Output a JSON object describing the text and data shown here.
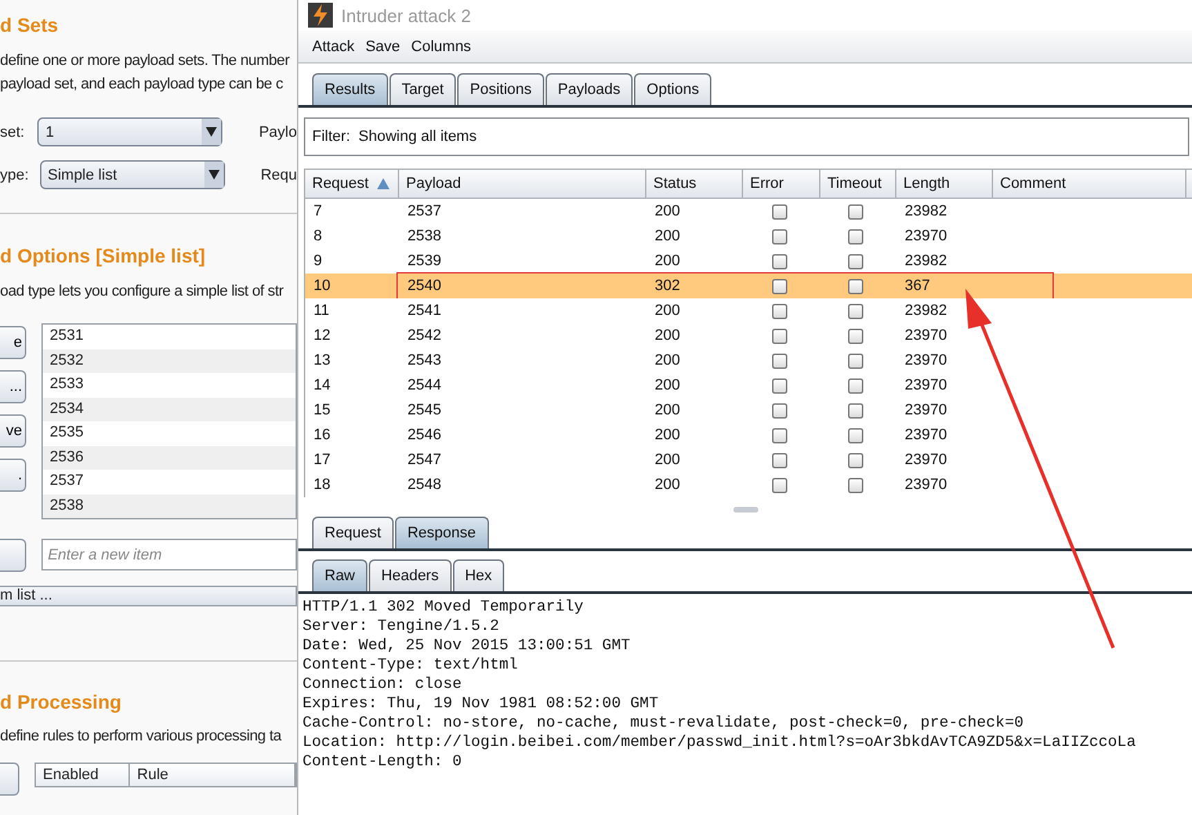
{
  "background_window": {
    "payload_sets": {
      "heading": "d Sets",
      "description": [
        "define one or more payload sets. The number",
        "payload set, and each payload type can be c"
      ],
      "fields": [
        {
          "label": "set:",
          "value": "1",
          "side_label": "Paylo"
        },
        {
          "label": "ype:",
          "value": "Simple list",
          "side_label": "Requ"
        }
      ]
    },
    "payload_options": {
      "heading": "d Options [Simple list]",
      "description": "oad type lets you configure a simple list of str",
      "buttons": [
        "e",
        "...",
        "ve",
        "."
      ],
      "items": [
        "2531",
        "2532",
        "2533",
        "2534",
        "2535",
        "2536",
        "2537",
        "2538"
      ],
      "new_item_placeholder": "Enter a new item",
      "list_dropdown": "m list ..."
    },
    "payload_processing": {
      "heading": "d Processing",
      "description": "define rules to perform various processing ta",
      "table_columns": [
        "Enabled",
        "Rule"
      ]
    }
  },
  "window": {
    "title": "Intruder attack 2",
    "menu": [
      "Attack",
      "Save",
      "Columns"
    ],
    "tabs": [
      {
        "label": "Results",
        "selected": true
      },
      {
        "label": "Target",
        "selected": false
      },
      {
        "label": "Positions",
        "selected": false
      },
      {
        "label": "Payloads",
        "selected": false
      },
      {
        "label": "Options",
        "selected": false
      }
    ],
    "filter": {
      "label": "Filter:",
      "value": "Showing all items"
    },
    "table": {
      "columns": [
        {
          "label": "Request",
          "sorted": true
        },
        {
          "label": "Payload",
          "sorted": false
        },
        {
          "label": "Status",
          "sorted": false
        },
        {
          "label": "Error",
          "sorted": false
        },
        {
          "label": "Timeout",
          "sorted": false
        },
        {
          "label": "Length",
          "sorted": false
        },
        {
          "label": "Comment",
          "sorted": false
        }
      ],
      "rows": [
        {
          "request": "7",
          "payload": "2537",
          "status": "200",
          "error": false,
          "timeout": false,
          "length": "23982",
          "selected": false,
          "annotated": false
        },
        {
          "request": "8",
          "payload": "2538",
          "status": "200",
          "error": false,
          "timeout": false,
          "length": "23970",
          "selected": false,
          "annotated": false
        },
        {
          "request": "9",
          "payload": "2539",
          "status": "200",
          "error": false,
          "timeout": false,
          "length": "23982",
          "selected": false,
          "annotated": false
        },
        {
          "request": "10",
          "payload": "2540",
          "status": "302",
          "error": false,
          "timeout": false,
          "length": "367",
          "selected": true,
          "annotated": true
        },
        {
          "request": "11",
          "payload": "2541",
          "status": "200",
          "error": false,
          "timeout": false,
          "length": "23982",
          "selected": false,
          "annotated": false
        },
        {
          "request": "12",
          "payload": "2542",
          "status": "200",
          "error": false,
          "timeout": false,
          "length": "23970",
          "selected": false,
          "annotated": false
        },
        {
          "request": "13",
          "payload": "2543",
          "status": "200",
          "error": false,
          "timeout": false,
          "length": "23970",
          "selected": false,
          "annotated": false
        },
        {
          "request": "14",
          "payload": "2544",
          "status": "200",
          "error": false,
          "timeout": false,
          "length": "23970",
          "selected": false,
          "annotated": false
        },
        {
          "request": "15",
          "payload": "2545",
          "status": "200",
          "error": false,
          "timeout": false,
          "length": "23970",
          "selected": false,
          "annotated": false
        },
        {
          "request": "16",
          "payload": "2546",
          "status": "200",
          "error": false,
          "timeout": false,
          "length": "23970",
          "selected": false,
          "annotated": false
        },
        {
          "request": "17",
          "payload": "2547",
          "status": "200",
          "error": false,
          "timeout": false,
          "length": "23970",
          "selected": false,
          "annotated": false
        },
        {
          "request": "18",
          "payload": "2548",
          "status": "200",
          "error": false,
          "timeout": false,
          "length": "23970",
          "selected": false,
          "annotated": false
        }
      ]
    },
    "message_tabs": [
      {
        "label": "Request",
        "selected": false
      },
      {
        "label": "Response",
        "selected": true
      }
    ],
    "view_tabs": [
      {
        "label": "Raw",
        "selected": true
      },
      {
        "label": "Headers",
        "selected": false
      },
      {
        "label": "Hex",
        "selected": false
      }
    ],
    "response_lines": [
      "HTTP/1.1 302 Moved Temporarily",
      "Server: Tengine/1.5.2",
      "Date: Wed, 25 Nov 2015 13:00:51 GMT",
      "Content-Type: text/html",
      "Connection: close",
      "Expires: Thu, 19 Nov 1981 08:52:00 GMT",
      "Cache-Control: no-store, no-cache, must-revalidate, post-check=0, pre-check=0",
      "Location: http://login.beibei.com/member/passwd_init.html?s=oAr3bkdAvTCA9ZD5&x=LaIIZccoLa",
      "Content-Length: 0"
    ]
  }
}
